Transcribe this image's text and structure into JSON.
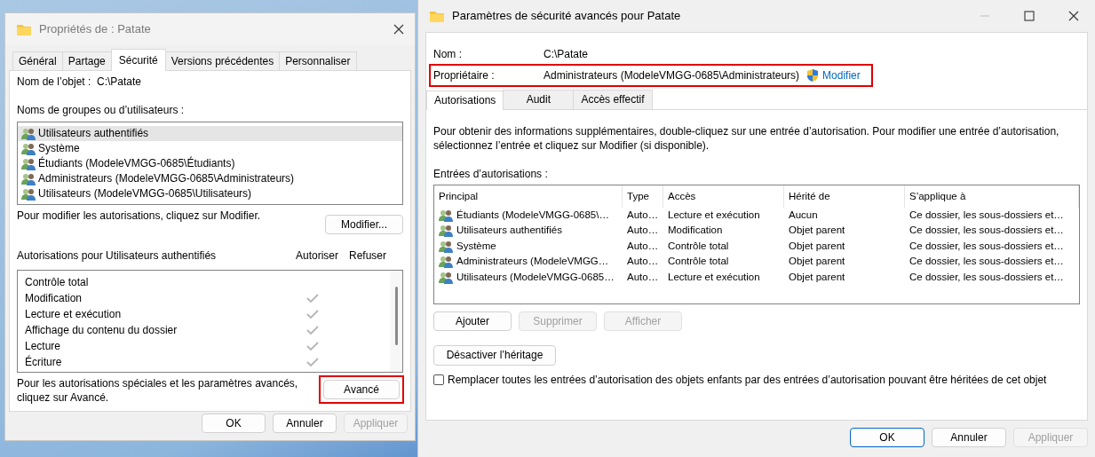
{
  "properties_window": {
    "title": "Propriétés de : Patate",
    "tabs": [
      {
        "label": "Général",
        "selected": false
      },
      {
        "label": "Partage",
        "selected": false
      },
      {
        "label": "Sécurité",
        "selected": true
      },
      {
        "label": "Versions précédentes",
        "selected": false
      },
      {
        "label": "Personnaliser",
        "selected": false
      }
    ],
    "object_name_label": "Nom de l’objet :",
    "object_name": "C:\\Patate",
    "groups_label": "Noms de groupes ou d’utilisateurs :",
    "groups": [
      {
        "name": "Utilisateurs authentifiés",
        "selected": true
      },
      {
        "name": "Système",
        "selected": false
      },
      {
        "name": "Étudiants (ModeleVMGG-0685\\Étudiants)",
        "selected": false
      },
      {
        "name": "Administrateurs (ModeleVMGG-0685\\Administrateurs)",
        "selected": false
      },
      {
        "name": "Utilisateurs (ModeleVMGG-0685\\Utilisateurs)",
        "selected": false
      }
    ],
    "modify_hint": "Pour modifier les autorisations, cliquez sur Modifier.",
    "modify_button": "Modifier...",
    "permissions_label": "Autorisations pour Utilisateurs authentifiés",
    "allow_header": "Autoriser",
    "deny_header": "Refuser",
    "permissions": [
      {
        "name": "Contrôle total",
        "allow": false
      },
      {
        "name": "Modification",
        "allow": true
      },
      {
        "name": "Lecture et exécution",
        "allow": true
      },
      {
        "name": "Affichage du contenu du dossier",
        "allow": true
      },
      {
        "name": "Lecture",
        "allow": true
      },
      {
        "name": "Écriture",
        "allow": true
      }
    ],
    "advanced_hint": "Pour les autorisations spéciales et les paramètres avancés, cliquez sur Avancé.",
    "advanced_button": {
      "label": "Avancé",
      "highlighted": true
    },
    "buttons": [
      {
        "label": "OK",
        "disabled": false
      },
      {
        "label": "Annuler",
        "disabled": false
      },
      {
        "label": "Appliquer",
        "disabled": true
      }
    ]
  },
  "advanced_window": {
    "title": "Paramètres de sécurité avancés pour Patate",
    "name_label": "Nom :",
    "name_value": "C:\\Patate",
    "owner_label": "Propriétaire :",
    "owner_value": "Administrateurs (ModeleVMGG-0685\\Administrateurs)",
    "owner_highlighted": true,
    "change_owner_link": "Modifier",
    "tabs": [
      {
        "label": "Autorisations",
        "selected": true
      },
      {
        "label": "Audit",
        "selected": false
      },
      {
        "label": "Accès effectif",
        "selected": false
      }
    ],
    "description": "Pour obtenir des informations supplémentaires, double-cliquez sur une entrée d’autorisation. Pour modifier une entrée d’autorisation, sélectionnez l’entrée et cliquez sur Modifier (si disponible).",
    "entries_label": "Entrées d’autorisations :",
    "columns": [
      "Principal",
      "Type",
      "Accès",
      "Hérité de",
      "S’applique à"
    ],
    "entries": [
      {
        "principal": "Étudiants (ModeleVMGG-0685\\…",
        "type": "Auto…",
        "access": "Lecture et exécution",
        "inherited_from": "Aucun",
        "applies_to": "Ce dossier, les sous-dossiers et…"
      },
      {
        "principal": "Utilisateurs authentifiés",
        "type": "Auto…",
        "access": "Modification",
        "inherited_from": "Objet parent",
        "applies_to": "Ce dossier, les sous-dossiers et…"
      },
      {
        "principal": "Système",
        "type": "Auto…",
        "access": "Contrôle total",
        "inherited_from": "Objet parent",
        "applies_to": "Ce dossier, les sous-dossiers et…"
      },
      {
        "principal": "Administrateurs (ModeleVMGG…",
        "type": "Auto…",
        "access": "Contrôle total",
        "inherited_from": "Objet parent",
        "applies_to": "Ce dossier, les sous-dossiers et…"
      },
      {
        "principal": "Utilisateurs (ModeleVMGG-0685…",
        "type": "Auto…",
        "access": "Lecture et exécution",
        "inherited_from": "Objet parent",
        "applies_to": "Ce dossier, les sous-dossiers et…"
      }
    ],
    "action_buttons": [
      {
        "label": "Ajouter",
        "disabled": false
      },
      {
        "label": "Supprimer",
        "disabled": true
      },
      {
        "label": "Afficher",
        "disabled": true
      }
    ],
    "disable_inheritance_button": "Désactiver l’héritage",
    "replace_checkbox": {
      "label": "Remplacer toutes les entrées d’autorisation des objets enfants par des entrées d’autorisation pouvant être héritées de cet objet",
      "checked": false
    },
    "buttons": [
      {
        "label": "OK",
        "disabled": false,
        "default": true
      },
      {
        "label": "Annuler",
        "disabled": false,
        "default": false
      },
      {
        "label": "Appliquer",
        "disabled": true,
        "default": false
      }
    ]
  }
}
